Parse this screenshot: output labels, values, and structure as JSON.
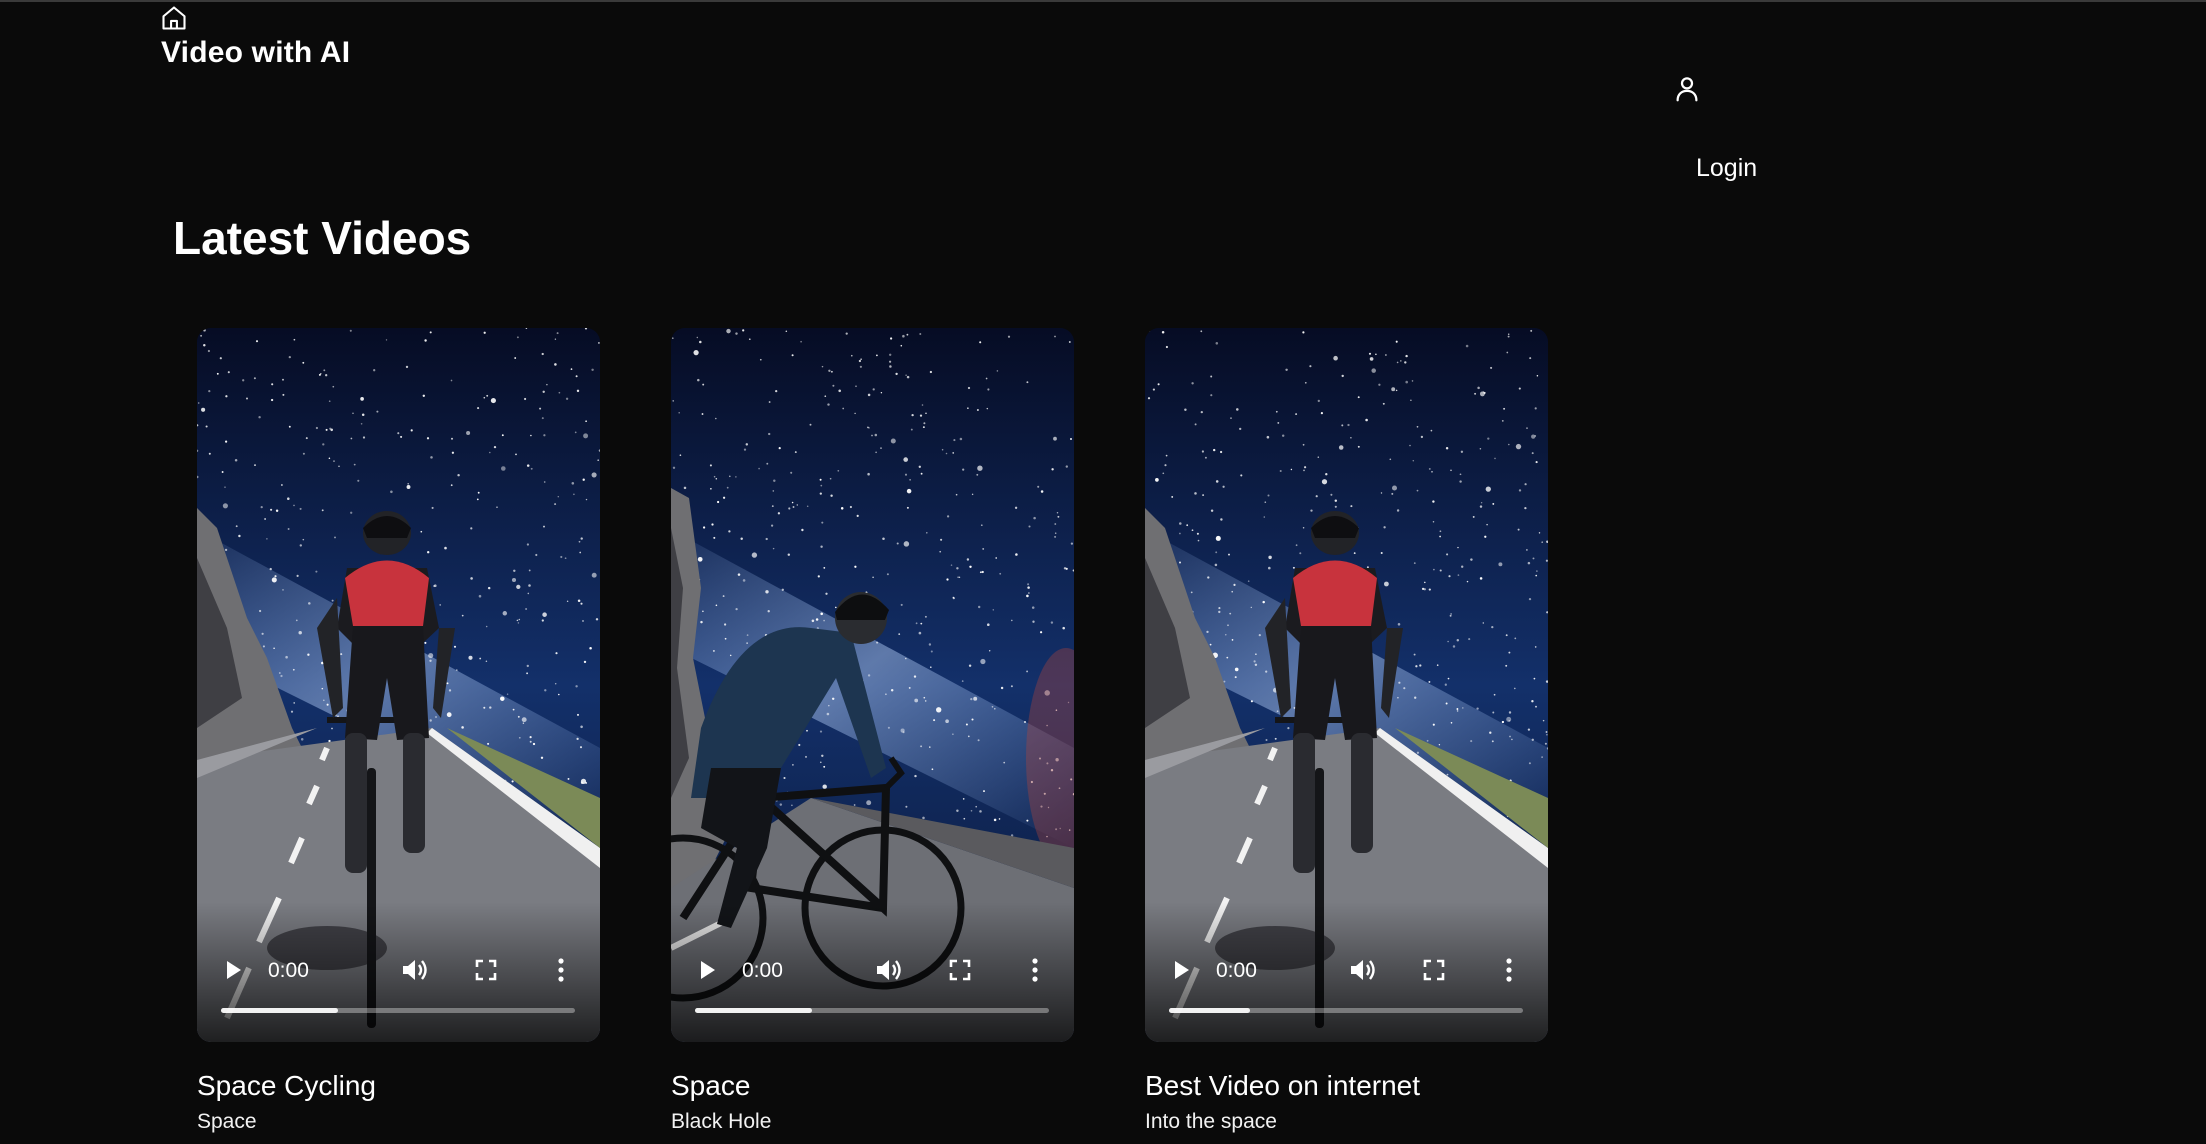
{
  "header": {
    "brand": "Video with AI",
    "login_label": "Login"
  },
  "icons": {
    "home": "home-icon",
    "user": "user-icon",
    "play": "play-icon",
    "volume": "volume-icon",
    "fullscreen": "fullscreen-icon",
    "more": "more-vertical-icon"
  },
  "section": {
    "title": "Latest Videos"
  },
  "videos": [
    {
      "title": "Space Cycling",
      "subtitle": "Space",
      "time": "0:00",
      "progress": 0.33,
      "scene": "rear"
    },
    {
      "title": "Space",
      "subtitle": "Black Hole",
      "time": "0:00",
      "progress": 0.33,
      "scene": "side"
    },
    {
      "title": "Best Video on internet",
      "subtitle": "Into the space",
      "time": "0:00",
      "progress": 0.23,
      "scene": "rear"
    }
  ],
  "colors": {
    "background": "#0a0a0a",
    "text": "#ffffff",
    "jersey_red": "#c8333d",
    "sky": "#0b1a3d"
  }
}
